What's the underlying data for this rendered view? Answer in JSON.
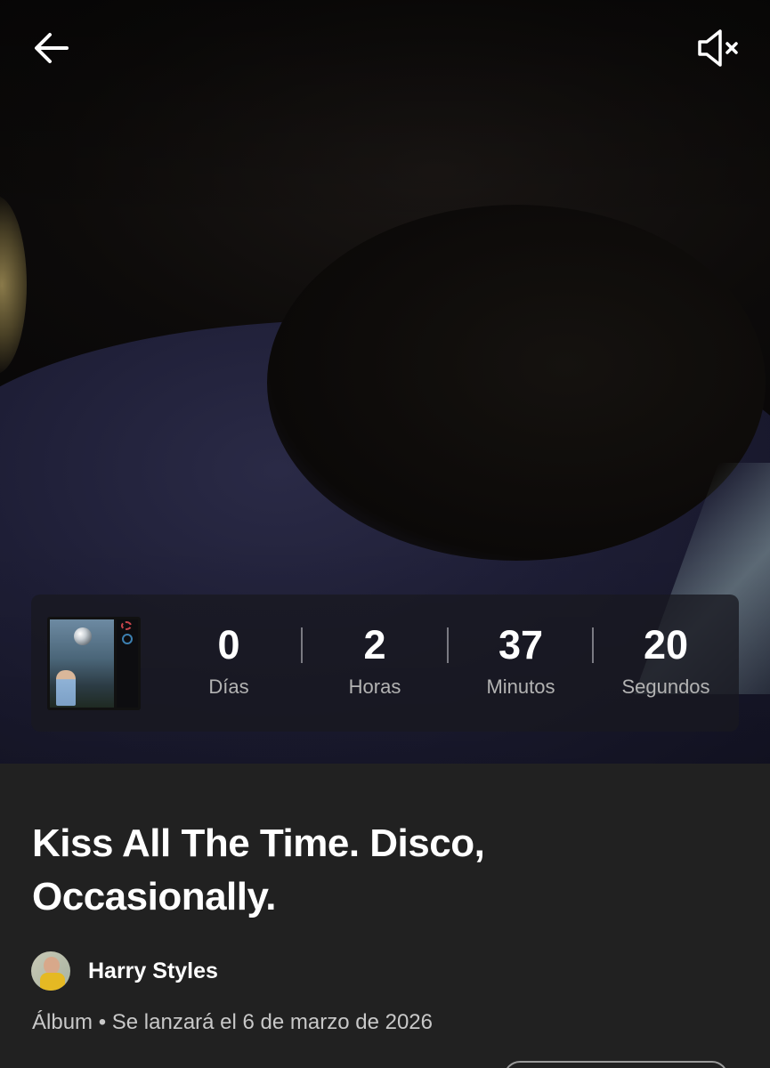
{
  "header": {
    "back_icon": "arrow-left-icon",
    "mute_icon": "speaker-muted-icon"
  },
  "countdown": {
    "units": [
      {
        "value": "0",
        "label": "Días"
      },
      {
        "value": "2",
        "label": "Horas"
      },
      {
        "value": "37",
        "label": "Minutos"
      },
      {
        "value": "20",
        "label": "Segundos"
      }
    ]
  },
  "album": {
    "title": "Kiss All The Time. Disco, Occasionally.",
    "artist": "Harry Styles",
    "meta": "Álbum • Se lanzará el 6 de marzo de 2026"
  },
  "colors": {
    "background": "#121212",
    "info_panel": "#212121",
    "countdown_card": "#18181f",
    "secondary_text": "#b3b3b3"
  }
}
